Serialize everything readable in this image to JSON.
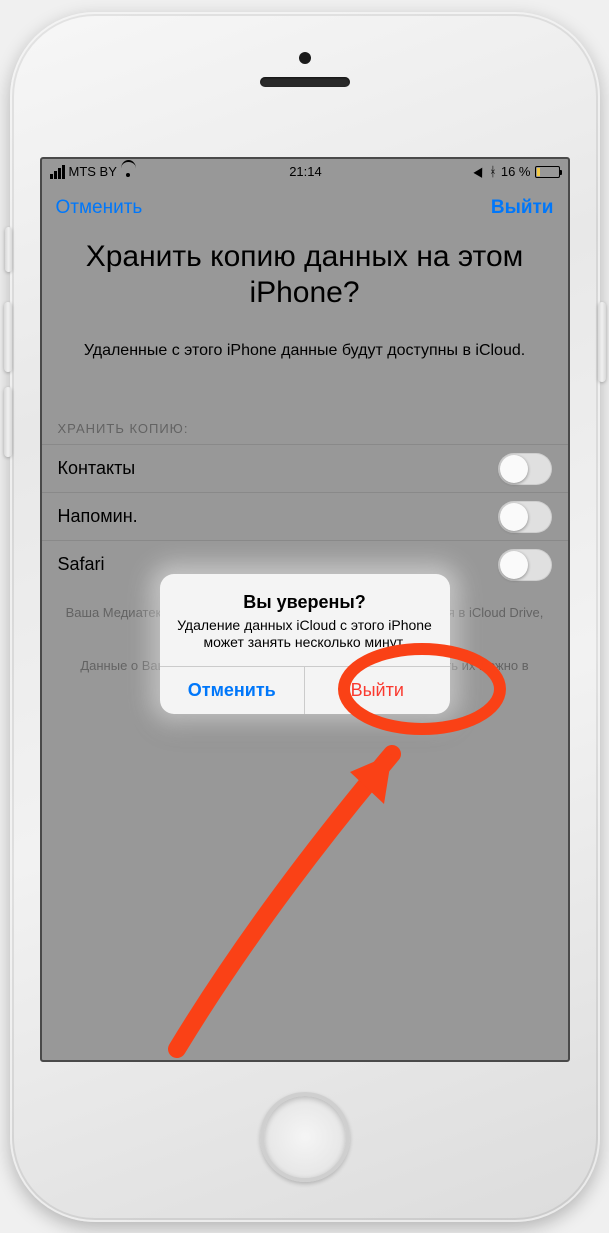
{
  "status": {
    "carrier": "MTS BY",
    "time": "21:14",
    "battery_pct": "16 %"
  },
  "nav": {
    "cancel": "Отменить",
    "sign_out": "Выйти"
  },
  "page": {
    "title": "Хранить копию данных на этом iPhone?",
    "subtitle": "Удаленные с этого iPhone данные будут доступны в iCloud."
  },
  "section": {
    "header": "ХРАНИТЬ КОПИЮ:",
    "rows": [
      {
        "label": "Контакты"
      },
      {
        "label": "Напомин."
      },
      {
        "label": "Safari"
      }
    ]
  },
  "footer": {
    "line1": "Ваша Медиатека iCloud и все документы и данные, хранящиеся в iCloud Drive, будут удалены с этого iPhone.",
    "line2": "Данные о Вашем здоровье останутся на этом iPhone. Удалить их можно в панели «Источники» программы «Здоровье»."
  },
  "alert": {
    "title": "Вы уверены?",
    "message": "Удаление данных iCloud с этого iPhone может занять несколько минут.",
    "cancel": "Отменить",
    "confirm": "Выйти"
  },
  "annotation_color": "#ff4317"
}
